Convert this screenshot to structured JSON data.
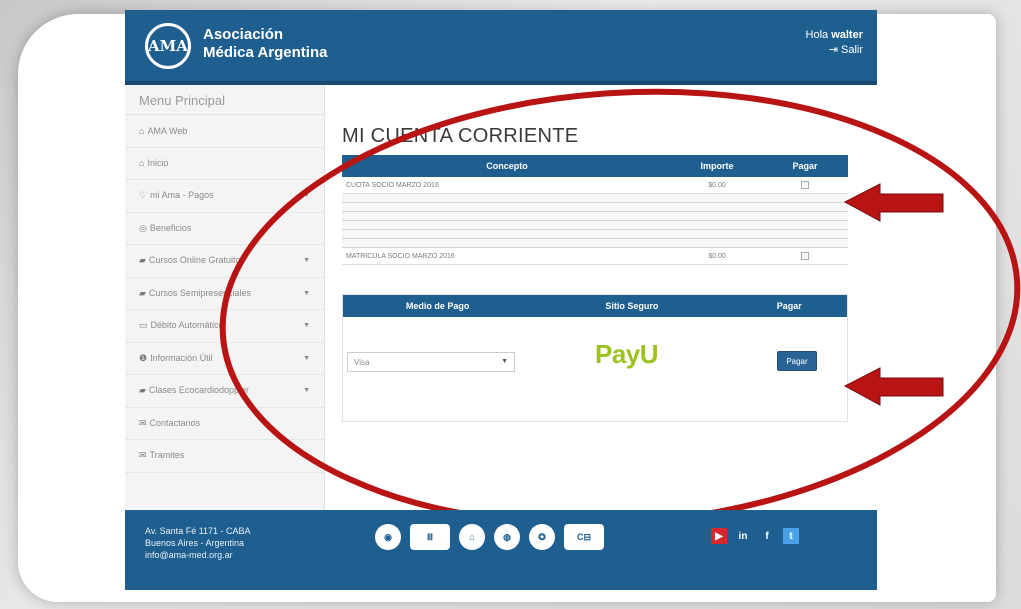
{
  "header": {
    "logo_mark": "AMA",
    "org_line1": "Asociación",
    "org_line2": "Médica Argentina",
    "greeting": "Hola",
    "username": "walter",
    "logout": "Salir"
  },
  "sidebar": {
    "title": "Menu Principal",
    "items": [
      {
        "label": "AMA Web",
        "icon": "home-icon",
        "submenu": false
      },
      {
        "label": "Inicio",
        "icon": "home-icon",
        "submenu": false
      },
      {
        "label": "mi Ama - Pagos",
        "icon": "heart-icon",
        "submenu": true
      },
      {
        "label": "Beneficios",
        "icon": "circle-icon",
        "submenu": false
      },
      {
        "label": "Cursos Online Gratuitos",
        "icon": "book-icon",
        "submenu": true
      },
      {
        "label": "Cursos Semipresenciales",
        "icon": "book-icon",
        "submenu": true
      },
      {
        "label": "Débito Automático",
        "icon": "card-icon",
        "submenu": true
      },
      {
        "label": "Información Útil",
        "icon": "info-icon",
        "submenu": true
      },
      {
        "label": "Clases Ecocardiodoppler",
        "icon": "book-icon",
        "submenu": true
      },
      {
        "label": "Contactanos",
        "icon": "mail-icon",
        "submenu": false
      },
      {
        "label": "Tramites",
        "icon": "mail-icon",
        "submenu": false
      }
    ]
  },
  "main": {
    "title": "MI CUENTA CORRIENTE",
    "table": {
      "headers": [
        "Concepto",
        "Importe",
        "Pagar"
      ],
      "rows": [
        {
          "concepto": "CUOTA SOCIO MARZO 2016",
          "importe": "$0.00"
        },
        {
          "concepto": "MATRICULA SOCIO MARZO 2016",
          "importe": "$0.00"
        }
      ]
    },
    "payment": {
      "headers": [
        "Medio de Pago",
        "Sitio Seguro",
        "Pagar"
      ],
      "method_selected": "Visa",
      "provider": "PayU",
      "button": "Pagar"
    }
  },
  "footer": {
    "address1": "Av. Santa Fé 1171 - CABA",
    "address2": "Buenos Aires - Argentina",
    "email": "info@ama-med.org.ar"
  },
  "colors": {
    "brand_blue": "#1f5f8f",
    "annotation_red": "#b81414"
  }
}
